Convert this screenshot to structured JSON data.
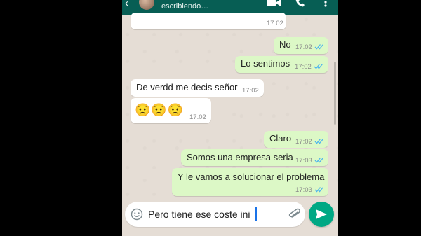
{
  "header": {
    "status": "escribiendo…",
    "icons": [
      "back-arrow-icon",
      "video-call-icon",
      "voice-call-icon",
      "more-options-icon"
    ]
  },
  "messages": [
    {
      "direction": "in",
      "text": "",
      "time": "17:02"
    },
    {
      "direction": "out",
      "text": "No",
      "time": "17:02",
      "read": true
    },
    {
      "direction": "out",
      "text": "Lo sentimos",
      "time": "17:02",
      "read": true
    },
    {
      "direction": "in",
      "text": "De verdd me decis señor",
      "time": "17:02"
    },
    {
      "direction": "in",
      "text": "😟😟😟",
      "time": "17:02"
    },
    {
      "direction": "out",
      "text": "Claro",
      "time": "17:02",
      "read": true
    },
    {
      "direction": "out",
      "text": "Somos una empresa seria",
      "time": "17:03",
      "read": true
    },
    {
      "direction": "out",
      "text": "Y le vamos a solucionar el problema",
      "time": "17:03",
      "read": true
    }
  ],
  "composer": {
    "value": "Pero tiene ese coste ini",
    "icons": [
      "emoji-icon",
      "attach-icon",
      "send-icon"
    ]
  },
  "colors": {
    "header": "#075e54",
    "chat_background": "#e5ddd5",
    "outgoing_bubble": "#dcf8c6",
    "incoming_bubble": "#ffffff",
    "read_ticks": "#4fb6ec",
    "send_button": "#00a884"
  }
}
